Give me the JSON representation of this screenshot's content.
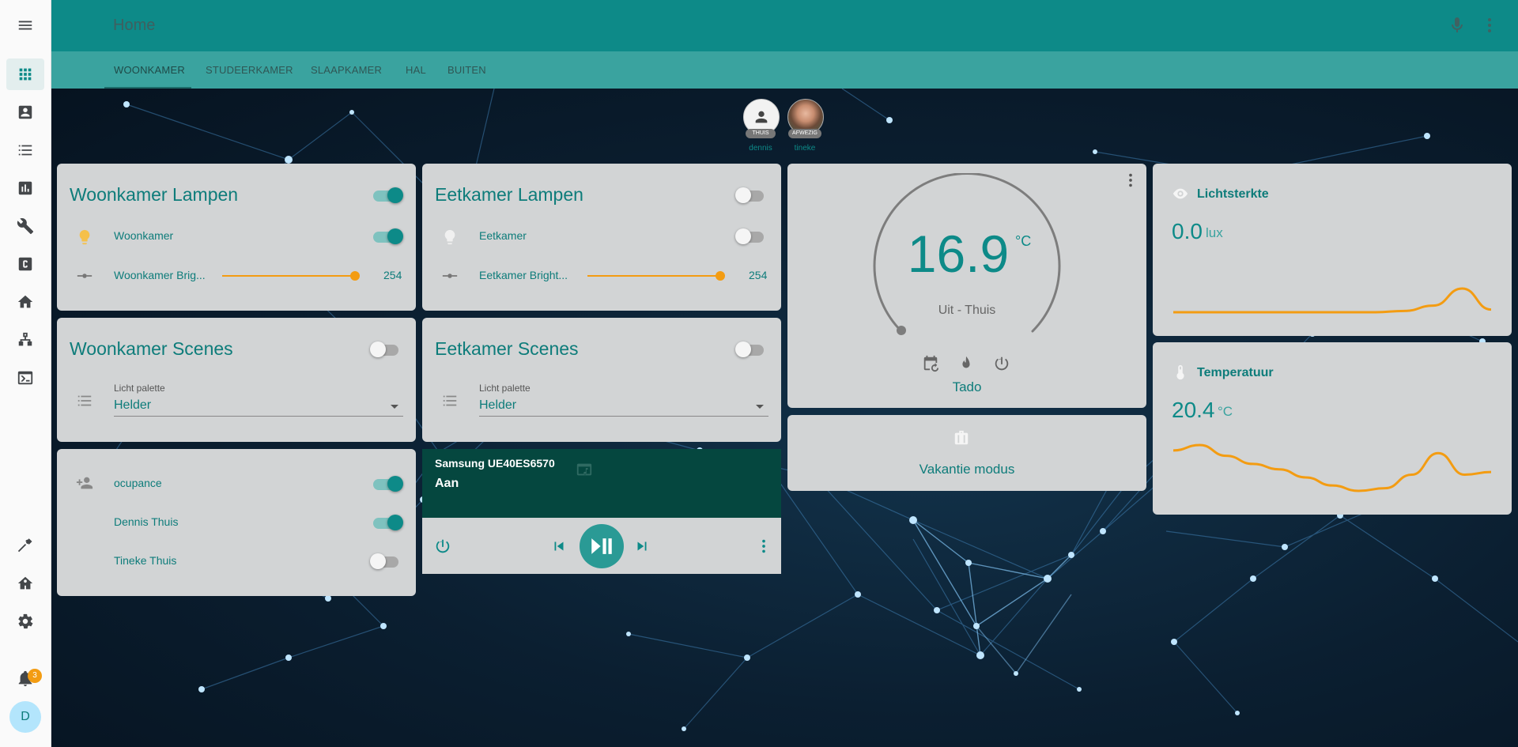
{
  "header": {
    "title": "Home"
  },
  "tabs": [
    {
      "label": "WOONKAMER",
      "active": true
    },
    {
      "label": "STUDEERKAMER",
      "active": false
    },
    {
      "label": "SLAAPKAMER",
      "active": false
    },
    {
      "label": "HAL",
      "active": false
    },
    {
      "label": "BUITEN",
      "active": false
    }
  ],
  "persons": [
    {
      "name": "dennis",
      "state": "THUIS"
    },
    {
      "name": "tineke",
      "state": "AFWEZIG"
    }
  ],
  "woonkamer_lampen": {
    "title": "Woonkamer Lampen",
    "toggle": true,
    "light_label": "Woonkamer",
    "light_on": true,
    "brightness_label": "Woonkamer Brig...",
    "brightness_value": "254"
  },
  "eetkamer_lampen": {
    "title": "Eetkamer Lampen",
    "toggle": false,
    "light_label": "Eetkamer",
    "light_on": false,
    "brightness_label": "Eetkamer Bright...",
    "brightness_value": "254"
  },
  "woonkamer_scenes": {
    "title": "Woonkamer Scenes",
    "toggle": false,
    "select_label": "Licht palette",
    "select_value": "Helder"
  },
  "eetkamer_scenes": {
    "title": "Eetkamer Scenes",
    "toggle": false,
    "select_label": "Licht palette",
    "select_value": "Helder"
  },
  "occupancy": {
    "rows": [
      {
        "label": "ocupance",
        "on": true
      },
      {
        "label": "Dennis Thuis",
        "on": true
      },
      {
        "label": "Tineke Thuis",
        "on": false
      }
    ]
  },
  "media": {
    "name": "Samsung UE40ES6570",
    "state": "Aan"
  },
  "thermostat": {
    "temperature": "16.9",
    "unit": "°C",
    "mode": "Uit - Thuis",
    "name": "Tado"
  },
  "vakantie": {
    "label": "Vakantie modus"
  },
  "lichtsterkte": {
    "title": "Lichtsterkte",
    "value": "0.0",
    "unit": "lux",
    "trend": [
      0,
      0,
      0,
      0,
      0,
      0,
      0,
      0,
      0.5,
      2.5,
      9,
      1
    ]
  },
  "temperatuur": {
    "title": "Temperatuur",
    "value": "20.4",
    "unit": "°C",
    "trend": [
      21.2,
      21.4,
      21.0,
      20.7,
      20.5,
      20.2,
      19.9,
      19.7,
      19.8,
      20.3,
      21.1,
      20.3,
      20.4
    ]
  },
  "notifications": {
    "count": "3"
  },
  "user": {
    "initial": "D"
  },
  "colors": {
    "primary": "#0d8a88",
    "accent": "#f39c12",
    "card": "#d2d4d5"
  }
}
